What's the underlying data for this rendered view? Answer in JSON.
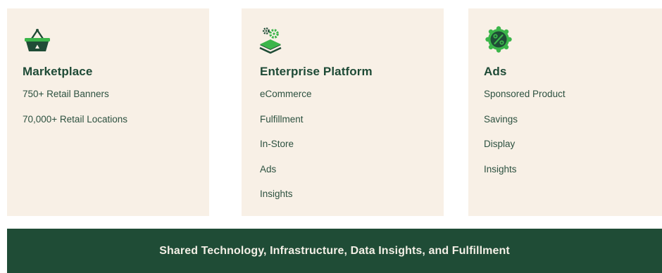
{
  "colors": {
    "card_background": "#f8f0e6",
    "primary_green": "#1f4c36",
    "accent_green": "#3bb54a",
    "footer_text": "#f3efe6"
  },
  "columns": [
    {
      "icon": "shopping-basket-icon",
      "title": "Marketplace",
      "items": [
        "750+ Retail Banners",
        "70,000+ Retail Locations"
      ]
    },
    {
      "icon": "platform-layers-gears-icon",
      "title": "Enterprise Platform",
      "items": [
        "eCommerce",
        "Fulfillment",
        "In-Store",
        "Ads",
        "Insights"
      ]
    },
    {
      "icon": "percent-badge-icon",
      "title": "Ads",
      "items": [
        "Sponsored Product",
        "Savings",
        "Display",
        "Insights"
      ]
    }
  ],
  "footer": {
    "text": "Shared Technology, Infrastructure, Data Insights, and Fulfillment"
  }
}
